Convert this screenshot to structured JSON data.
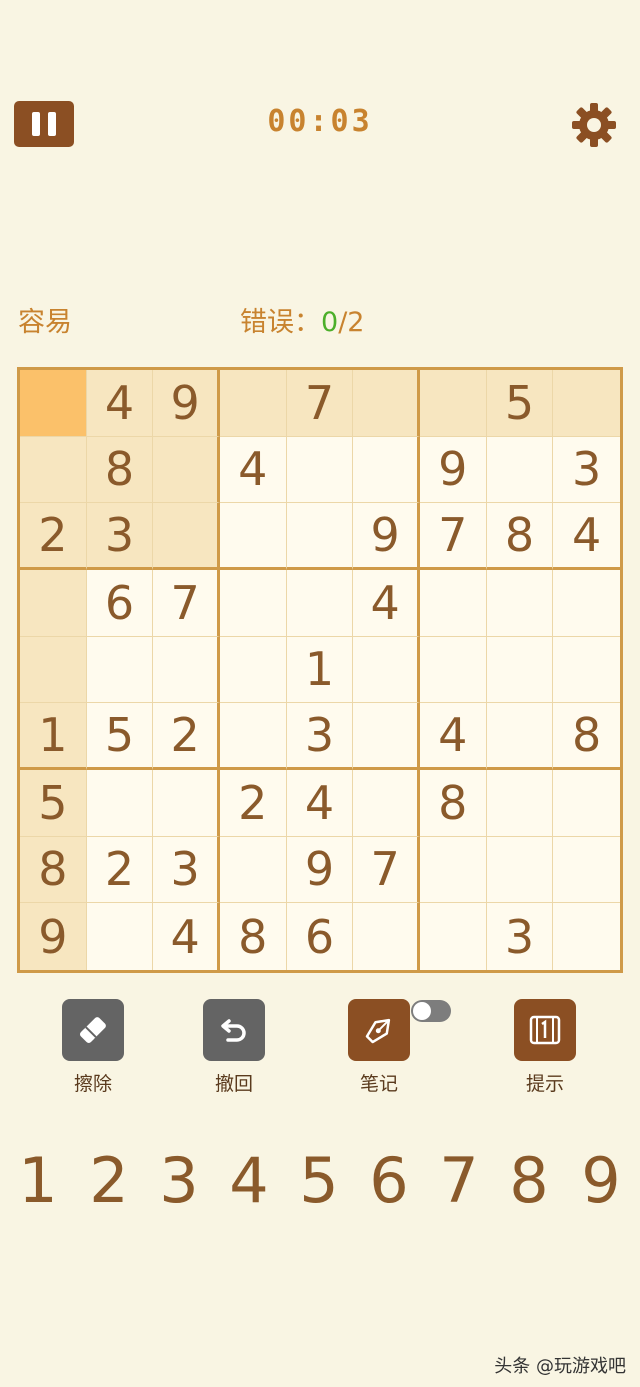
{
  "header": {
    "timer": "00:03"
  },
  "info": {
    "difficulty": "容易",
    "errors_label": "错误：",
    "errors_count": "0",
    "errors_total": "/2"
  },
  "board": {
    "rows": [
      [
        "",
        "4",
        "9",
        "",
        "7",
        "",
        "",
        "5",
        ""
      ],
      [
        "",
        "8",
        "",
        "4",
        "",
        "",
        "9",
        "",
        "3"
      ],
      [
        "2",
        "3",
        "",
        "",
        "",
        "9",
        "7",
        "8",
        "4"
      ],
      [
        "",
        "6",
        "7",
        "",
        "",
        "4",
        "",
        "",
        ""
      ],
      [
        "",
        "",
        "",
        "",
        "1",
        "",
        "",
        "",
        ""
      ],
      [
        "1",
        "5",
        "2",
        "",
        "3",
        "",
        "4",
        "",
        "8"
      ],
      [
        "5",
        "",
        "",
        "2",
        "4",
        "",
        "8",
        "",
        ""
      ],
      [
        "8",
        "2",
        "3",
        "",
        "9",
        "7",
        "",
        "",
        ""
      ],
      [
        "9",
        "",
        "4",
        "8",
        "6",
        "",
        "",
        "3",
        ""
      ]
    ],
    "selected": {
      "row": 0,
      "col": 0
    }
  },
  "tools": [
    {
      "label": "擦除",
      "icon": "eraser-icon",
      "style": "gray"
    },
    {
      "label": "撤回",
      "icon": "undo-icon",
      "style": "gray"
    },
    {
      "label": "笔记",
      "icon": "pen-icon",
      "style": "brown"
    },
    {
      "label": "提示",
      "icon": "hint-icon",
      "style": "brown"
    }
  ],
  "notes_toggle": {
    "on": false
  },
  "numpad": [
    "1",
    "2",
    "3",
    "4",
    "5",
    "6",
    "7",
    "8",
    "9"
  ],
  "watermark": "头条 @玩游戏吧",
  "colors": {
    "background": "#f9f5e3",
    "accent_brown": "#8b4f23",
    "timer": "#c8832f",
    "error_count": "#4caf2a",
    "selected_cell": "#fbc16a",
    "highlight_cell": "#f7e6c0"
  }
}
